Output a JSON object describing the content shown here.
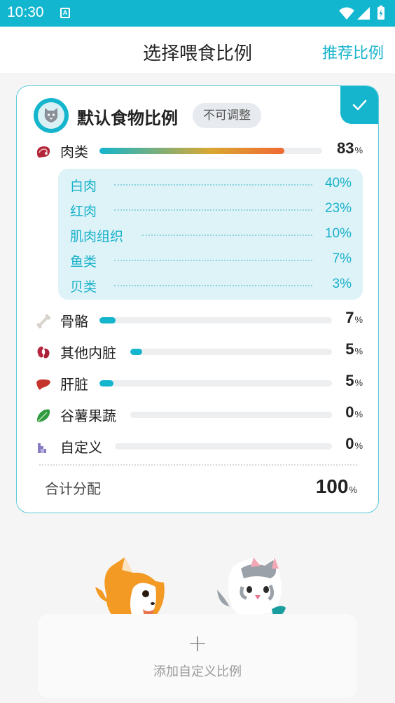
{
  "status_bar": {
    "time": "10:30",
    "notification_glyph": "A"
  },
  "app_bar": {
    "title": "选择喂食比例",
    "action": "推荐比例"
  },
  "card": {
    "title": "默认食物比例",
    "badge": "不可调整",
    "selected": true,
    "items": [
      {
        "name": "肉类",
        "value": "83",
        "unit": "%",
        "fraction": 0.83,
        "icon": "meat-icon"
      },
      {
        "name": "骨骼",
        "value": "7",
        "unit": "%",
        "fraction": 0.07,
        "icon": "bone-icon"
      },
      {
        "name": "其他内脏",
        "value": "5",
        "unit": "%",
        "fraction": 0.05,
        "icon": "kidney-icon"
      },
      {
        "name": "肝脏",
        "value": "5",
        "unit": "%",
        "fraction": 0.05,
        "icon": "liver-icon"
      },
      {
        "name": "谷薯果蔬",
        "value": "0",
        "unit": "%",
        "fraction": 0.0,
        "icon": "vegetable-icon"
      },
      {
        "name": "自定义",
        "value": "0",
        "unit": "%",
        "fraction": 0.0,
        "icon": "custom-icon"
      }
    ],
    "meat_breakdown": [
      {
        "name": "白肉",
        "value": "40%"
      },
      {
        "name": "红肉",
        "value": "23%"
      },
      {
        "name": "肌肉组织",
        "value": "10%"
      },
      {
        "name": "鱼类",
        "value": "7%"
      },
      {
        "name": "贝类",
        "value": "3%"
      }
    ],
    "total_label": "合计分配",
    "total_value": "100",
    "total_unit": "%"
  },
  "add_custom": {
    "plus": "+",
    "label": "添加自定义比例"
  },
  "colors": {
    "accent": "#14b5cd",
    "meat_bar_start": "#14b5cd",
    "meat_bar_end": "#f06a35"
  }
}
